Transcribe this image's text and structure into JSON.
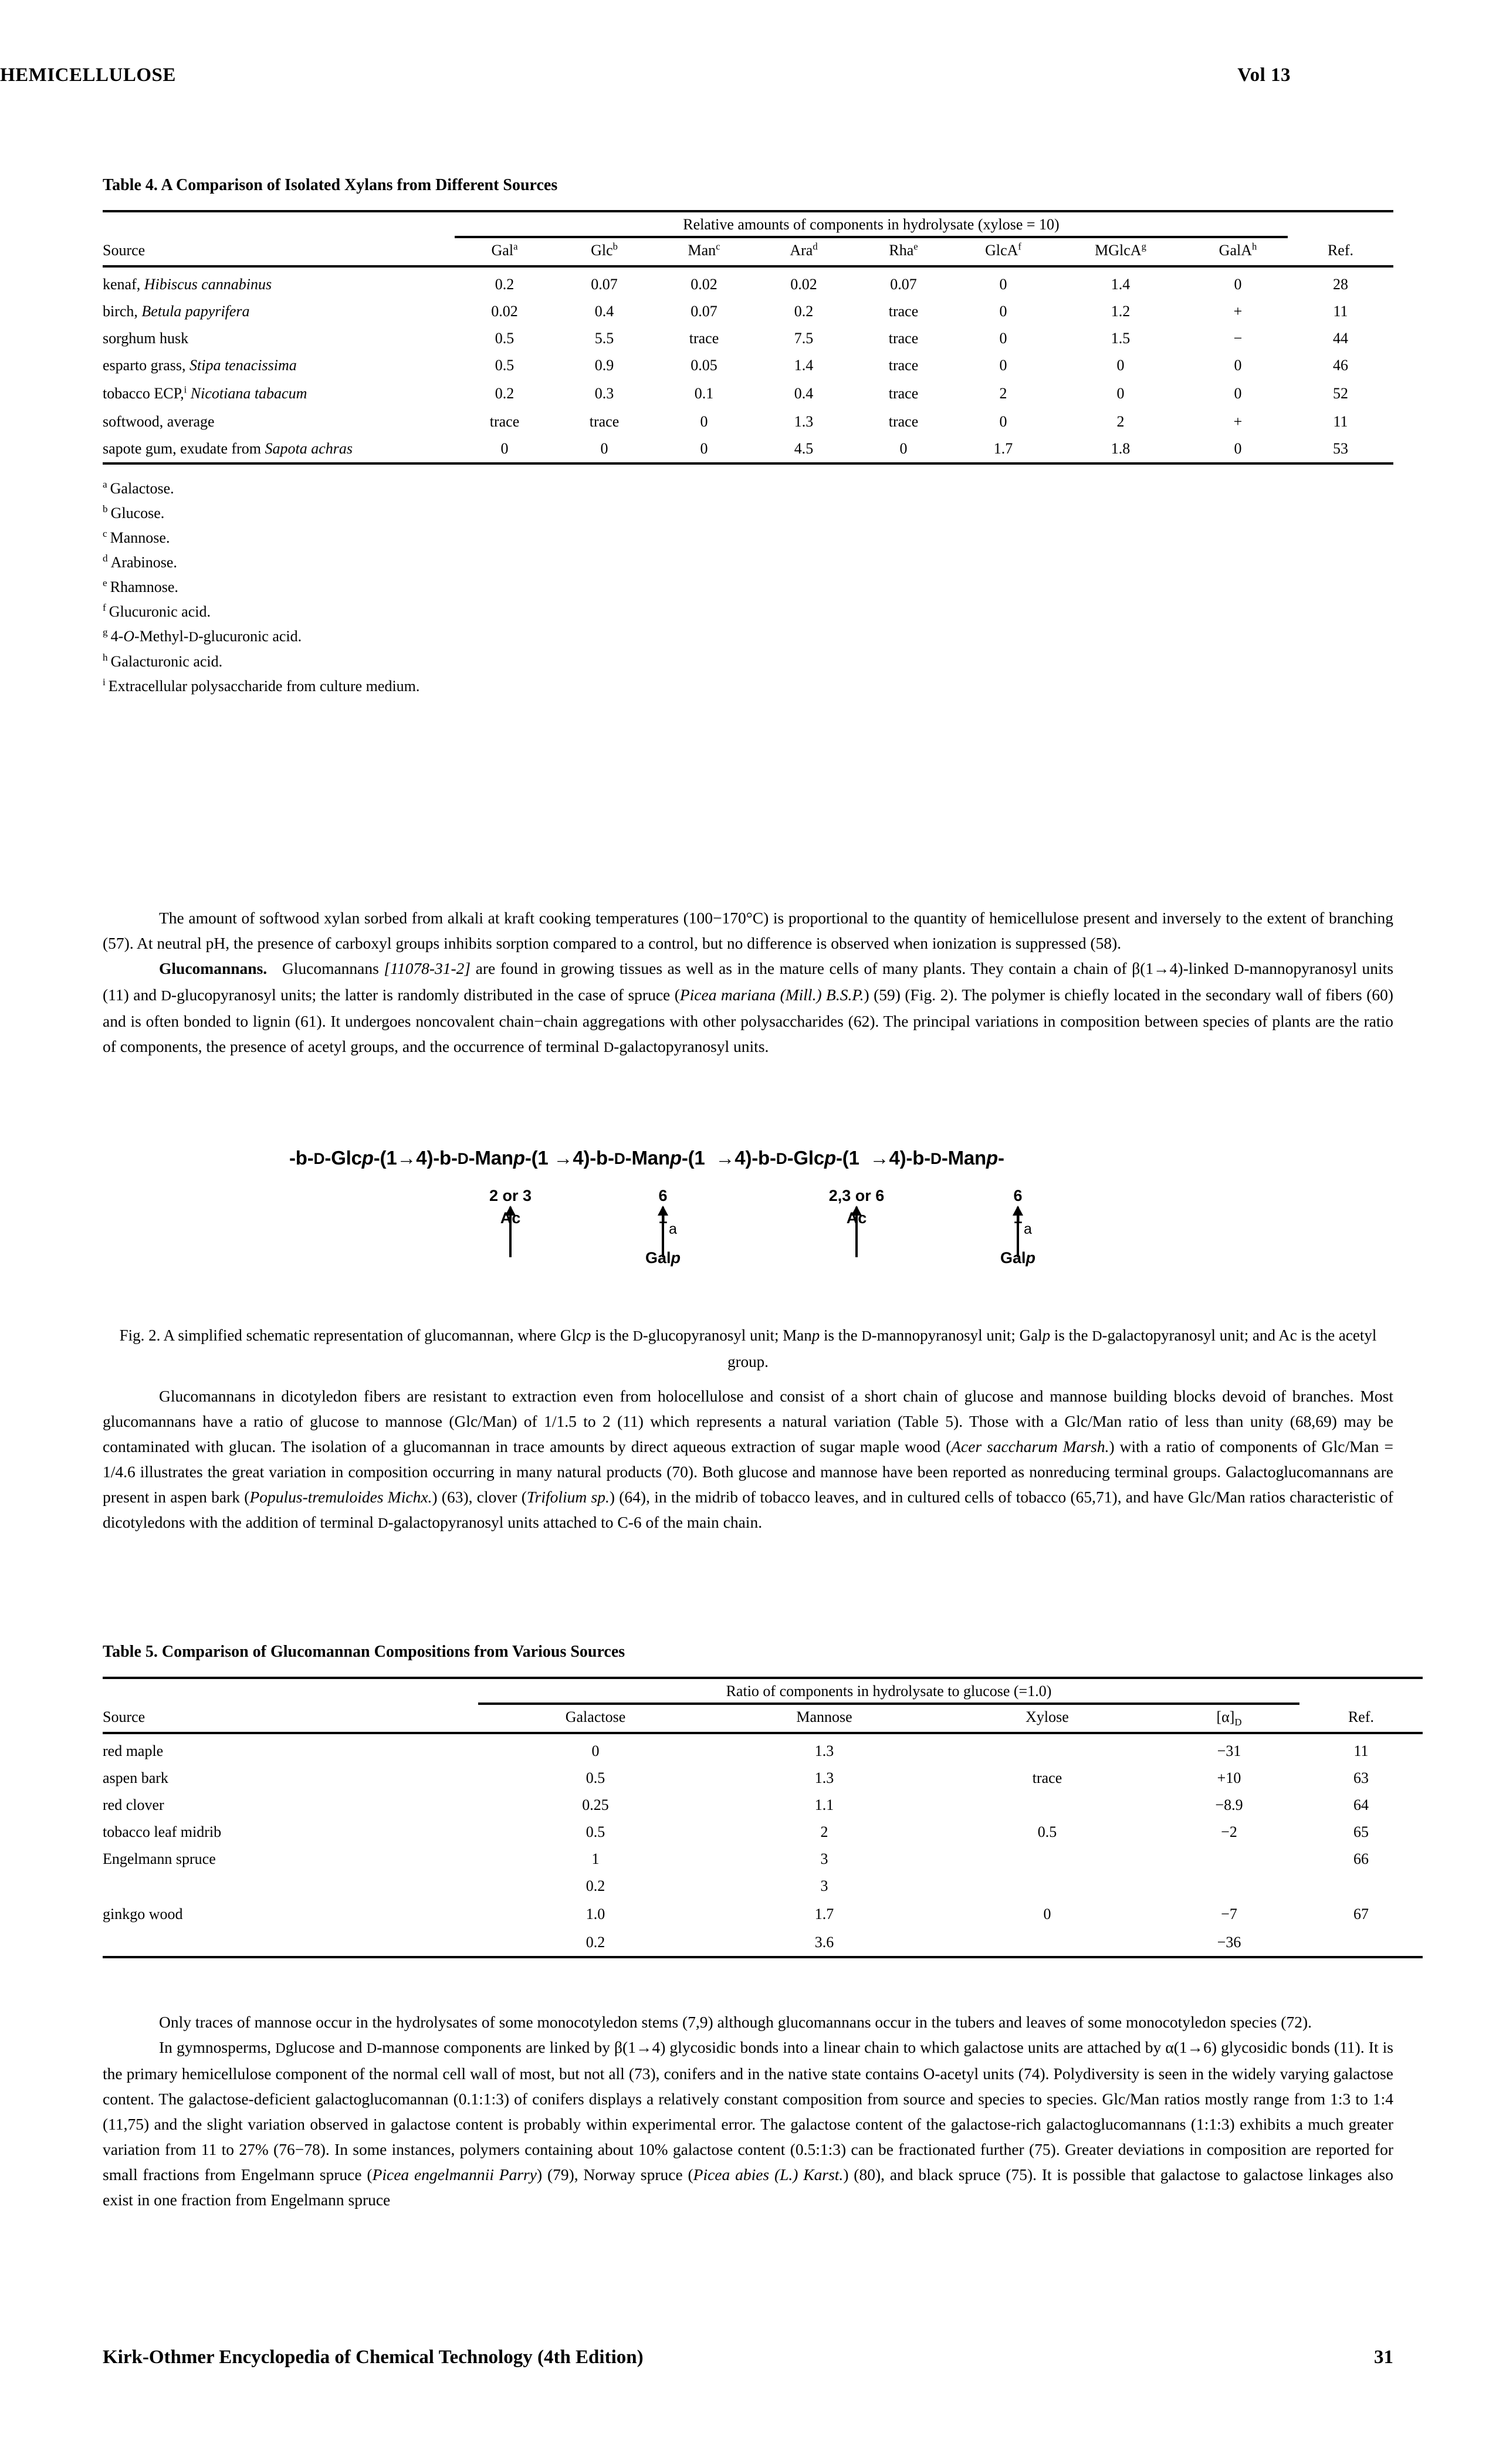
{
  "runhead": {
    "left": "HEMICELLULOSE",
    "right": "Vol 13"
  },
  "table4": {
    "title": "Table 4. A Comparison of Isolated Xylans from Different Sources",
    "spanner": "Relative amounts of components in hydrolysate (xylose = 10)",
    "col_source": "Source",
    "col_ref": "Ref.",
    "columns": [
      {
        "label": "Gal",
        "mark": "a"
      },
      {
        "label": "Glc",
        "mark": "b"
      },
      {
        "label": "Man",
        "mark": "c"
      },
      {
        "label": "Ara",
        "mark": "d"
      },
      {
        "label": "Rha",
        "mark": "e"
      },
      {
        "label": "GlcA",
        "mark": "f"
      },
      {
        "label": "MGlcA",
        "mark": "g"
      },
      {
        "label": "GalA",
        "mark": "h"
      }
    ],
    "rows": [
      {
        "source": "kenaf, ",
        "source_it": "Hibiscus cannabinus",
        "source_tail": "",
        "mark": "",
        "values": [
          "0.2",
          "0.07",
          "0.02",
          "0.02",
          "0.07",
          "0",
          "1.4",
          "0"
        ],
        "ref": "28"
      },
      {
        "source": "birch, ",
        "source_it": "Betula papyrifera",
        "source_tail": "",
        "mark": "",
        "values": [
          "0.02",
          "0.4",
          "0.07",
          "0.2",
          "trace",
          "0",
          "1.2",
          "+"
        ],
        "ref": "11"
      },
      {
        "source": "sorghum husk",
        "source_it": "",
        "source_tail": "",
        "mark": "",
        "values": [
          "0.5",
          "5.5",
          "trace",
          "7.5",
          "trace",
          "0",
          "1.5",
          "−"
        ],
        "ref": "44"
      },
      {
        "source": "esparto grass, ",
        "source_it": "Stipa tenacissima",
        "source_tail": "",
        "mark": "",
        "values": [
          "0.5",
          "0.9",
          "0.05",
          "1.4",
          "trace",
          "0",
          "0",
          "0"
        ],
        "ref": "46"
      },
      {
        "source": "tobacco ECP,",
        "source_it": "Nicotiana tabacum",
        "source_tail": "",
        "mark": "i",
        "values": [
          "0.2",
          "0.3",
          "0.1",
          "0.4",
          "trace",
          "2",
          "0",
          "0"
        ],
        "ref": "52"
      },
      {
        "source": "softwood, average",
        "source_it": "",
        "source_tail": "",
        "mark": "",
        "values": [
          "trace",
          "trace",
          "0",
          "1.3",
          "trace",
          "0",
          "2",
          "+"
        ],
        "ref": "11"
      },
      {
        "source": "sapote gum, exudate from ",
        "source_it": "Sapota achras",
        "source_tail": "",
        "mark": "",
        "values": [
          "0",
          "0",
          "0",
          "4.5",
          "0",
          "1.7",
          "1.8",
          "0"
        ],
        "ref": "53"
      }
    ],
    "footnotes": [
      {
        "mark": "a",
        "text": "Galactose."
      },
      {
        "mark": "b",
        "text": "Glucose."
      },
      {
        "mark": "c",
        "text": "Mannose."
      },
      {
        "mark": "d",
        "text": "Arabinose."
      },
      {
        "mark": "e",
        "text": "Rhamnose."
      },
      {
        "mark": "f",
        "text": "Glucuronic acid."
      },
      {
        "mark": "g",
        "text": "4-O-Methyl-D-glucuronic acid."
      },
      {
        "mark": "h",
        "text": "Galacturonic acid."
      },
      {
        "mark": "i",
        "text": "Extracellular polysaccharide from culture medium."
      }
    ]
  },
  "body": {
    "p1": "The amount of softwood xylan sorbed from alkali at kraft cooking temperatures (100−170°C) is proportional to the quantity of hemicellulose present and inversely to the extent of branching (57). At neutral pH, the presence of carboxyl groups inhibits sorption compared to a control, but no difference is observed when ionization is suppressed (58).",
    "p2_head": "Glucomannans.",
    "p2_cas": "[11078-31-2]",
    "p2_a": "Glucomannans",
    "p2_b": "are found in growing tissues as well as in the mature cells of many plants. They contain a chain of β(1→4)-linked",
    "p2_c": "-mannopyranosyl units (11) and",
    "p2_d": "-glucopyranosyl units; the latter is randomly distributed in the case of spruce (",
    "p2_e": "Picea mariana (Mill.) B.S.P.",
    "p2_f": ") (59) (Fig. 2). The polymer is chiefly located in the secondary wall of fibers (60) and is often bonded to lignin (61). It undergoes noncovalent chain−chain aggregations with other polysaccharides (62). The principal variations in composition between species of plants are the ratio of components, the presence of acetyl groups, and the occurrence of terminal",
    "p2_g": "-galactopyranosyl units.",
    "p3_a": "Glucomannans in dicotyledon fibers are resistant to extraction even from holocellulose and consist of a short chain of glucose and mannose building blocks devoid of branches. Most glucomannans have a ratio of glucose to mannose (Glc/Man) of 1/1.5 to 2 (11) which represents a natural variation (Table 5). Those with a Glc/Man ratio of less than unity (68,69) may be contaminated with glucan. The isolation of a glucomannan in trace amounts by direct aqueous extraction of sugar maple wood (",
    "p3_it1": "Acer saccharum Marsh.",
    "p3_b": ") with a ratio of components of Glc/Man = 1/4.6 illustrates the great variation in composition occurring in many natural products (70). Both glucose and mannose have been reported as nonreducing terminal groups. Galactoglucomannans are present in aspen bark (",
    "p3_it2": "Populus-tremuloides Michx.",
    "p3_c": ") (63), clover (",
    "p3_it3": "Trifolium sp.",
    "p3_d": ") (64), in the midrib of tobacco leaves, and in cultured cells of tobacco (65,71), and have Glc/Man ratios characteristic of dicotyledons with the addition of terminal",
    "p3_e": "-galactopyranosyl units attached to C-6 of the main chain.",
    "p4": "Only traces of mannose occur in the hydrolysates of some monocotyledon stems (7,9) although glucomannans occur in the tubers and leaves of some monocotyledon species (72).",
    "p5_a": "In gymnosperms,",
    "p5_b": "glucose and",
    "p5_c": "-mannose components are linked by β(1→4) glycosidic bonds into a linear chain to which galactose units are attached by α(1→6) glycosidic bonds (11). It is the primary hemicellulose component of the normal cell wall of most, but not all (73), conifers and in the native state contains O-acetyl units (74). Polydiversity is seen in the widely varying galactose content. The galactose-deficient galactoglucomannan (0.1:1:3) of conifers displays a relatively constant composition from source and species to species. Glc/Man ratios mostly range from 1:3 to 1:4 (11,75) and the slight variation observed in galactose content is probably within experimental error. The galactose content of the galactose-rich galactoglucomannans (1:1:3) exhibits a much greater variation from 11 to 27% (76−78). In some instances, polymers containing about 10% galactose content (0.5:1:3) can be fractionated further (75). Greater deviations in composition are reported for small fractions from Engelmann spruce (",
    "p5_it1": "Picea engelmannii Parry",
    "p5_d": ") (79), Norway spruce (",
    "p5_it2": "Picea abies (L.) Karst.",
    "p5_e": ") (80), and black spruce (75). It is possible that galactose to galactose linkages also exist in one fraction from Engelmann spruce"
  },
  "figure2": {
    "chain": [
      {
        "t": "-b-",
        "k": "plain"
      },
      {
        "t": "D",
        "k": "smallcap"
      },
      {
        "t": "-Glc",
        "k": "plain"
      },
      {
        "t": "p",
        "k": "italic"
      },
      {
        "t": "-(1",
        "k": "plain"
      },
      {
        "t": "→4)-b-",
        "k": "plain"
      },
      {
        "t": "D",
        "k": "smallcap"
      },
      {
        "t": "-Man",
        "k": "plain"
      },
      {
        "t": "p",
        "k": "italic"
      },
      {
        "t": "-(1",
        "k": "plain"
      },
      {
        "t": "→4)-b-",
        "k": "plain"
      },
      {
        "t": "D",
        "k": "smallcap"
      },
      {
        "t": "-Man",
        "k": "plain"
      },
      {
        "t": "p",
        "k": "italic"
      },
      {
        "t": "-(1",
        "k": "plain"
      },
      {
        "t": "→4)-b-",
        "k": "plain"
      },
      {
        "t": "D",
        "k": "smallcap"
      },
      {
        "t": "-Glc",
        "k": "plain"
      },
      {
        "t": "p",
        "k": "italic"
      },
      {
        "t": "-(1",
        "k": "plain"
      },
      {
        "t": "→4)-b-",
        "k": "plain"
      },
      {
        "t": "D",
        "k": "smallcap"
      },
      {
        "t": "-Man",
        "k": "plain"
      },
      {
        "t": "p",
        "k": "italic"
      },
      {
        "t": "-",
        "k": "plain"
      }
    ],
    "chain_text": "-b-D-Glcp-(1→4)-b-D-Manp-(1 →4)-b-D-Manp-(1 →4)-b-D-Glcp-(1 →4)-b-D-Manp-",
    "branches": [
      {
        "position": "2 or 3",
        "linkage": "",
        "base": "Ac",
        "leaf": ""
      },
      {
        "position": "6",
        "linkage": "a",
        "base": "1",
        "leaf": "Galp"
      },
      {
        "position": "2,3 or 6",
        "linkage": "",
        "base": "Ac",
        "leaf": ""
      },
      {
        "position": "6",
        "linkage": "a",
        "base": "1",
        "leaf": "Galp"
      }
    ],
    "caption_a": "Fig. 2. A simplified schematic representation of glucomannan, where Glc",
    "caption_p1": "p",
    "caption_b": " is the ",
    "caption_c": "-glucopyranosyl unit; Man",
    "caption_p2": "p",
    "caption_d": " is the ",
    "caption_e": "-mannopyranosyl unit; Gal",
    "caption_p3": "p",
    "caption_f": " is the ",
    "caption_g": "-galactopyranosyl unit; and Ac is the acetyl group."
  },
  "table5": {
    "title": "Table 5. Comparison of Glucomannan Compositions from Various Sources",
    "spanner": "Ratio of components in hydrolysate to glucose (=1.0)",
    "col_source": "Source",
    "col_ref": "Ref.",
    "col_rotation": "[α]",
    "col_rotation_sub": "D",
    "columns": [
      "Galactose",
      "Mannose",
      "Xylose"
    ],
    "rows": [
      {
        "source": "red maple",
        "galactose": "0",
        "mannose": "1.3",
        "xylose": "",
        "rotation": "−31",
        "ref": "11"
      },
      {
        "source": "aspen bark",
        "galactose": "0.5",
        "mannose": "1.3",
        "xylose": "trace",
        "rotation": "+10",
        "ref": "63"
      },
      {
        "source": "red clover",
        "galactose": "0.25",
        "mannose": "1.1",
        "xylose": "",
        "rotation": "−8.9",
        "ref": "64"
      },
      {
        "source": "tobacco leaf midrib",
        "galactose": "0.5",
        "mannose": "2",
        "xylose": "0.5",
        "rotation": "−2",
        "ref": "65"
      },
      {
        "source": "Engelmann spruce",
        "galactose": "1",
        "mannose": "3",
        "xylose": "",
        "rotation": "",
        "ref": "66"
      },
      {
        "source": "",
        "galactose": "0.2",
        "mannose": "3",
        "xylose": "",
        "rotation": "",
        "ref": ""
      },
      {
        "source": "ginkgo wood",
        "galactose": "1.0",
        "mannose": "1.7",
        "xylose": "0",
        "rotation": "−7",
        "ref": "67"
      },
      {
        "source": "",
        "galactose": "0.2",
        "mannose": "3.6",
        "xylose": "",
        "rotation": "−36",
        "ref": ""
      }
    ]
  },
  "footer": {
    "left": "Kirk-Othmer Encyclopedia of Chemical Technology (4th Edition)",
    "right": "31"
  }
}
